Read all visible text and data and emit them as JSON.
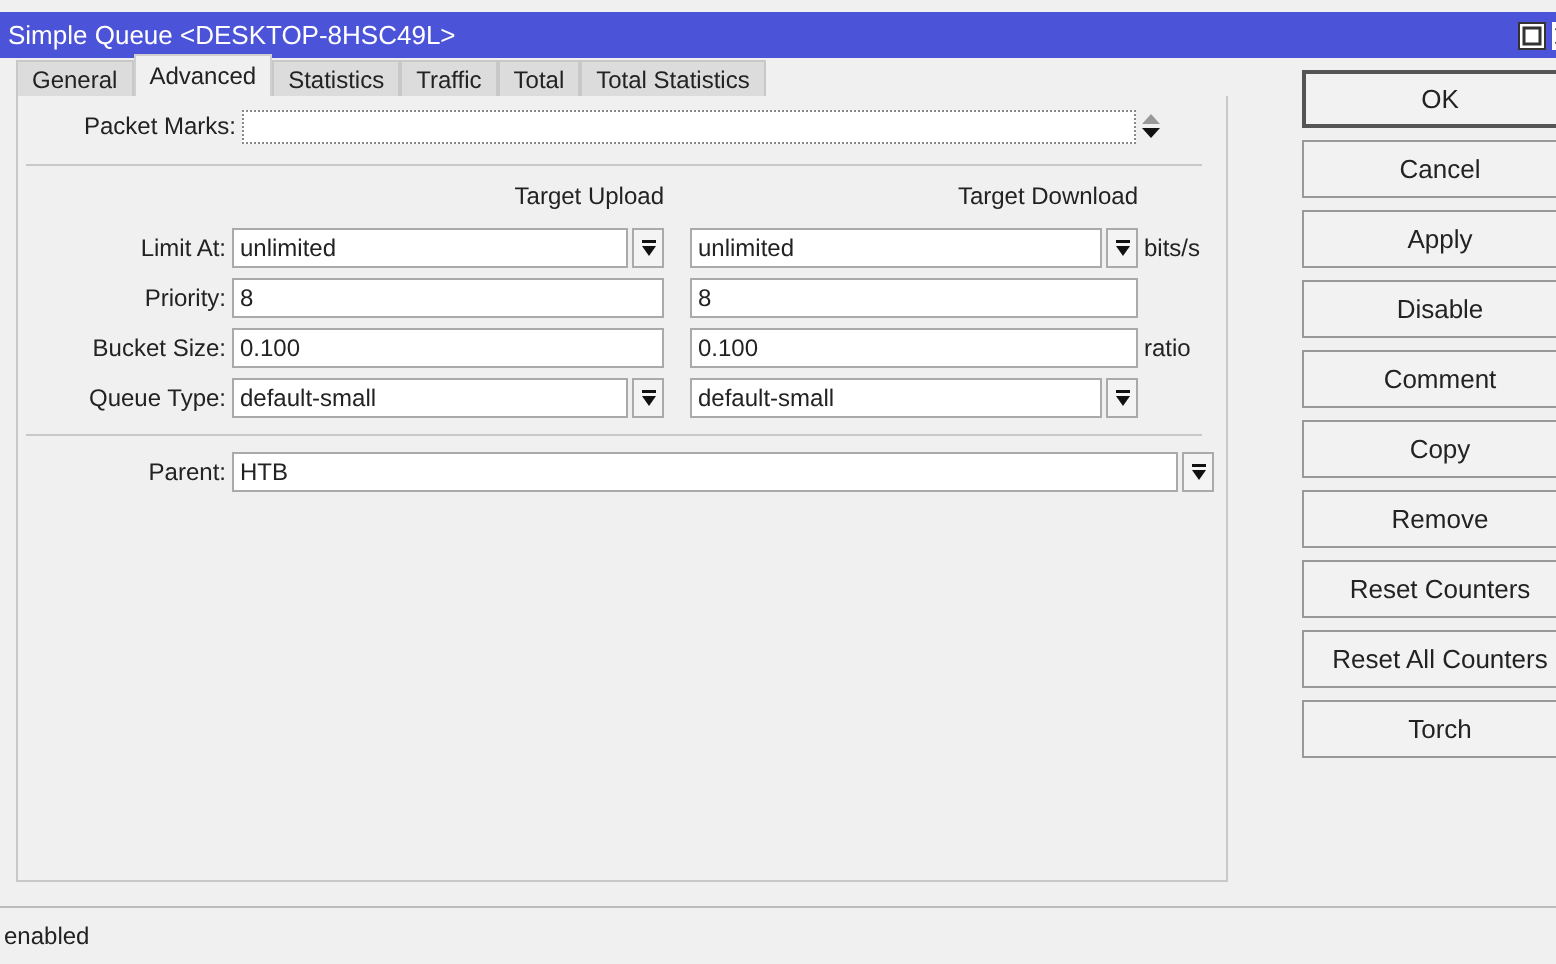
{
  "window": {
    "title": "Simple Queue <DESKTOP-8HSC49L>"
  },
  "tabs": [
    {
      "label": "General",
      "selected": false
    },
    {
      "label": "Advanced",
      "selected": true
    },
    {
      "label": "Statistics",
      "selected": false
    },
    {
      "label": "Traffic",
      "selected": false
    },
    {
      "label": "Total",
      "selected": false
    },
    {
      "label": "Total Statistics",
      "selected": false
    }
  ],
  "packet_marks": {
    "label": "Packet Marks:"
  },
  "columns": [
    "Target Upload",
    "Target Download"
  ],
  "rows": [
    {
      "label": "Limit At:",
      "kind": "dropdown",
      "upload": "unlimited",
      "download": "unlimited",
      "unit": "bits/s"
    },
    {
      "label": "Priority:",
      "kind": "text",
      "upload": "8",
      "download": "8"
    },
    {
      "label": "Bucket Size:",
      "kind": "text",
      "upload": "0.100",
      "download": "0.100",
      "unit": "ratio"
    },
    {
      "label": "Queue Type:",
      "kind": "dropdown",
      "upload": "default-small",
      "download": "default-small"
    }
  ],
  "parent": {
    "label": "Parent:",
    "value": "HTB"
  },
  "buttons": [
    "OK",
    "Cancel",
    "Apply",
    "Disable",
    "Comment",
    "Copy",
    "Remove",
    "Reset Counters",
    "Reset All Counters",
    "Torch"
  ],
  "status_bar": "enabled"
}
